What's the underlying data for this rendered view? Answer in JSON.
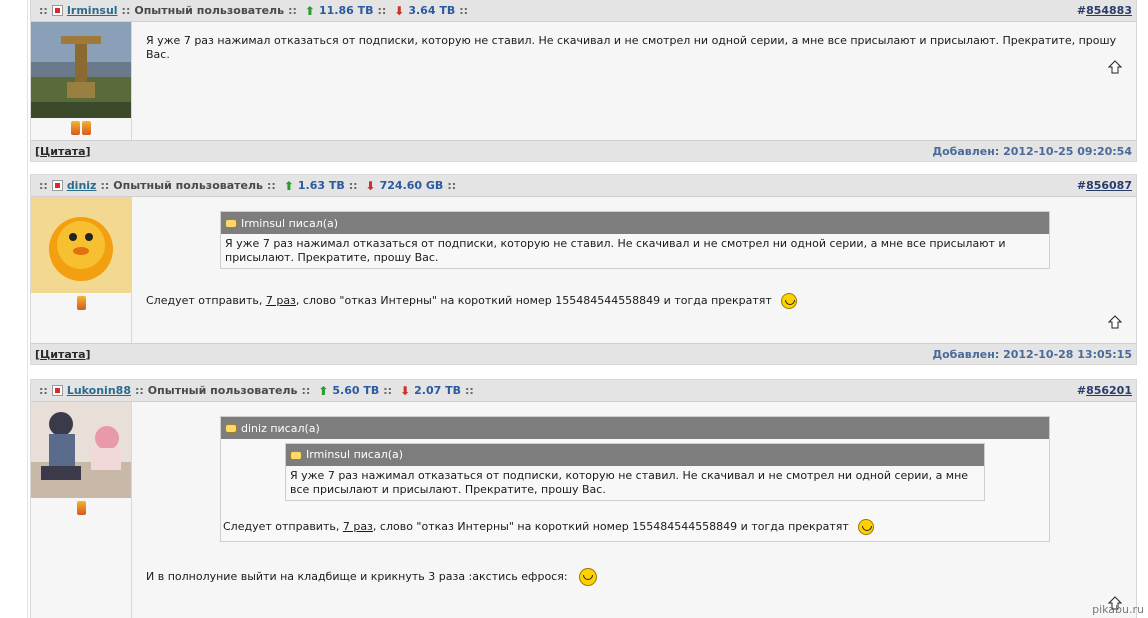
{
  "posts": [
    {
      "user": "Irminsul",
      "rank": "Опытный пользователь",
      "upload": "11.86 TB",
      "download": "3.64 TB",
      "post_id": "854883",
      "medals": 2,
      "text": "Я уже 7 раз нажимал отказаться от подписки, которую не ставил. Не скачивал и не смотрел ни одной серии, а мне все присылают и присылают. Прекратите, прошу Вас.",
      "footer": {
        "cite": "Цитата",
        "added": "Добавлен: 2012-10-25 09:20:54"
      }
    },
    {
      "user": "diniz",
      "rank": "Опытный пользователь",
      "upload": "1.63 TB",
      "download": "724.60 GB",
      "post_id": "856087",
      "medals": 1,
      "quote": {
        "author": "Irminsul писал(а)",
        "text": "Я уже 7 раз нажимал отказаться от подписки, которую не ставил. Не скачивал и не смотрел ни одной серии, а мне все присылают и присылают. Прекратите, прошу Вас."
      },
      "text_before": "Следует отправить, ",
      "text_link": "7 раз",
      "text_after": ", слово \"отказ Интерны\" на короткий номер 155484544558849 и тогда прекратят",
      "footer": {
        "cite": "Цитата",
        "added": "Добавлен: 2012-10-28 13:05:15"
      }
    },
    {
      "user": "Lukonin88",
      "rank": "Опытный пользователь",
      "upload": "5.60 TB",
      "download": "2.07 TB",
      "post_id": "856201",
      "medals": 1,
      "quote": {
        "author": "diniz писал(а)",
        "inner_quote": {
          "author": "Irminsul писал(а)",
          "text": "Я уже 7 раз нажимал отказаться от подписки, которую не ставил. Не скачивал и не смотрел ни одной серии, а мне все присылают и присылают. Прекратите, прошу Вас."
        },
        "text_before": "Следует отправить, ",
        "text_link": "7 раз",
        "text_after": ", слово \"отказ Интерны\" на короткий номер 155484544558849 и тогда прекратят"
      },
      "text": "И в полнолуние выйти на кладбище и крикнуть 3 раза :акстись ефрося:"
    }
  ],
  "labels": {
    "sep": "::",
    "hash": "#"
  },
  "watermark": "pikabu.ru",
  "colors": {
    "header_bg": "#e4e4e4",
    "quote_head_bg": "#7d7d7d",
    "user_link": "#2a6c8a",
    "upload_arrow": "#2c9c2c",
    "download_arrow": "#d0302a"
  }
}
